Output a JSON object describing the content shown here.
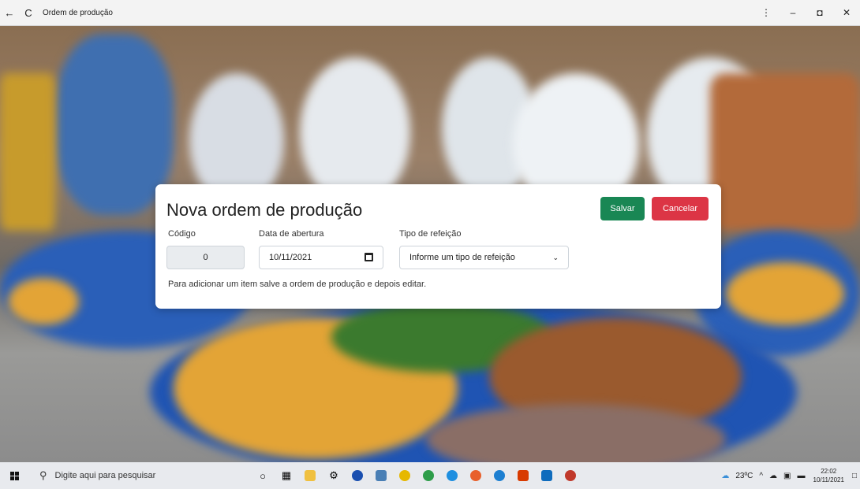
{
  "window": {
    "title": "Ordem de produção",
    "back_glyph": "←",
    "reload_glyph": "C",
    "menu_glyph": "⋮",
    "minimize_glyph": "–",
    "maximize_glyph": "◘",
    "close_glyph": "✕"
  },
  "modal": {
    "title": "Nova ordem de produção",
    "save_label": "Salvar",
    "cancel_label": "Cancelar",
    "code_label": "Código",
    "code_value": "0",
    "date_label": "Data de abertura",
    "date_value": "10/11/2021",
    "meal_type_label": "Tipo de refeição",
    "meal_type_value": "Informe um tipo de refeição",
    "note": "Para adicionar um item salve a ordem de produção e depois editar."
  },
  "taskbar": {
    "search_placeholder": "Digite aqui para pesquisar",
    "temperature": "23ºC",
    "time": "22:02",
    "date": "10/11/2021",
    "apps": [
      "cortana-icon",
      "task-view-icon",
      "file-explorer-icon",
      "settings-icon",
      "app-blue-icon",
      "calculator-icon",
      "chrome-icon",
      "chrome-2-icon",
      "skype-icon",
      "firefox-icon",
      "edge-icon",
      "office-icon",
      "outlook-icon",
      "red-app-icon"
    ]
  },
  "colors": {
    "save": "#198754",
    "cancel": "#dc3545"
  }
}
